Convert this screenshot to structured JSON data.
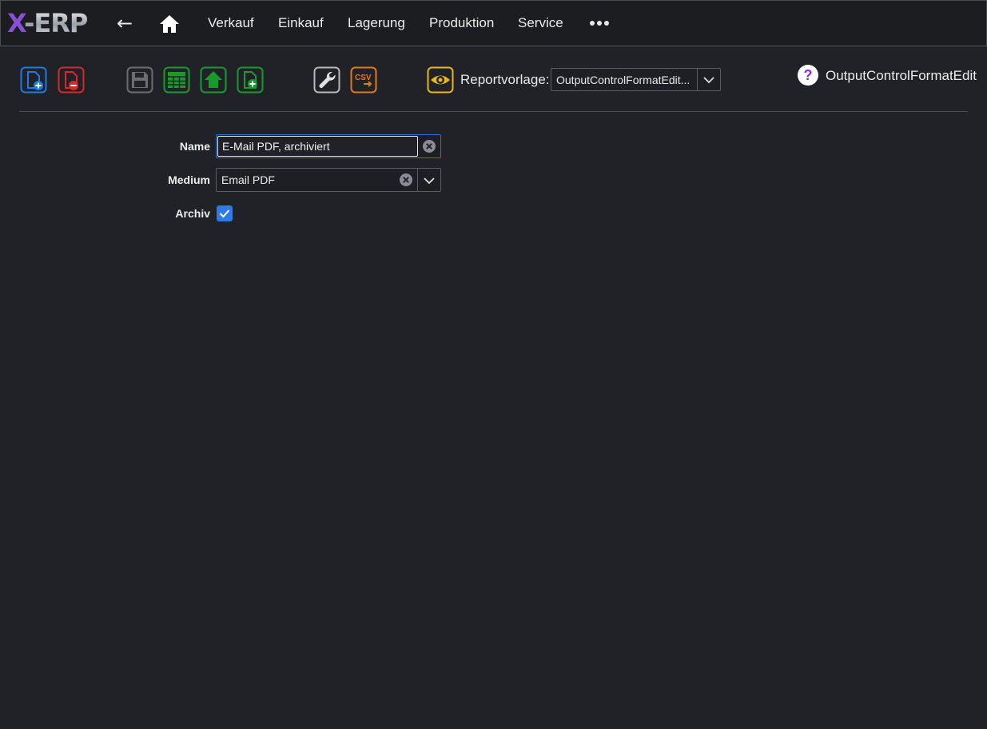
{
  "app": {
    "logo_x": "X",
    "logo_rest": "-ERP"
  },
  "nav": {
    "back": "←",
    "items": [
      "Verkauf",
      "Einkauf",
      "Lagerung",
      "Produktion",
      "Service"
    ]
  },
  "toolbar": {
    "icons": [
      {
        "name": "new-document-icon",
        "color": "#1e7be0"
      },
      {
        "name": "delete-document-icon",
        "color": "#d42a2a"
      },
      {
        "name": "save-icon",
        "color": "#6b6d72"
      },
      {
        "name": "table-icon",
        "color": "#1a9a2c"
      },
      {
        "name": "upload-home-icon",
        "color": "#1a9a2c"
      },
      {
        "name": "add-document-icon",
        "color": "#1a9a2c"
      },
      {
        "name": "wrench-icon",
        "color": "#b8b8b8"
      },
      {
        "name": "csv-export-icon",
        "color": "#e07a1a"
      }
    ],
    "report_label": "Reportvorlage:",
    "report_value": "OutputControlFormatEdit...",
    "help_label": "OutputControlFormatEdit"
  },
  "form": {
    "name_label": "Name",
    "name_value": "E-Mail PDF, archiviert",
    "medium_label": "Medium",
    "medium_value": "Email PDF",
    "archiv_label": "Archiv",
    "archiv_checked": true
  },
  "colors": {
    "background": "#202228",
    "accent": "#2f7ae5",
    "eye": "#e8b81a",
    "help": "#8a2be2"
  }
}
